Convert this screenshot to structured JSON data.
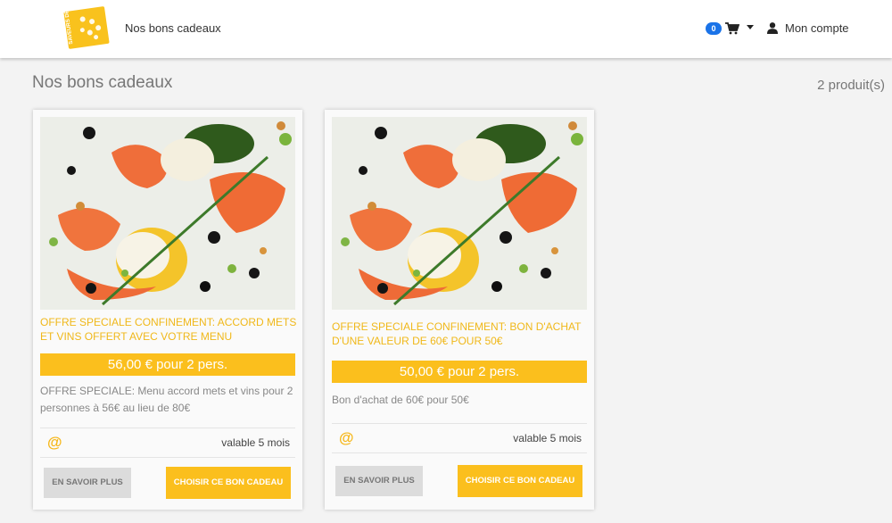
{
  "header": {
    "logo_text": "SAVEURS DES GRANDS CRUS",
    "nav_link": "Nos bons cadeaux",
    "cart_count": "0",
    "account_label": "Mon compte"
  },
  "page": {
    "title": "Nos bons cadeaux",
    "product_count": "2 produit(s)"
  },
  "products": [
    {
      "title": "OFFRE SPECIALE CONFINEMENT: ACCORD METS ET VINS OFFERT AVEC VOTRE MENU",
      "price": "56,00 € pour 2 pers.",
      "description": "OFFRE SPECIALE: Menu accord mets et vins pour 2 personnes à 56€ au lieu de 80€",
      "validity": "valable 5 mois",
      "more_label": "EN SAVOIR PLUS",
      "choose_label": "CHOISIR CE BON CADEAU"
    },
    {
      "title": "OFFRE SPECIALE CONFINEMENT: BON D'ACHAT D'UNE VALEUR DE 60€ POUR 50€",
      "price": "50,00 € pour 2 pers.",
      "description": "Bon d'achat de 60€ pour 50€",
      "validity": "valable 5 mois",
      "more_label": "EN SAVOIR PLUS",
      "choose_label": "CHOISIR CE BON CADEAU"
    }
  ],
  "colors": {
    "accent": "#fbbf1d",
    "title_text": "#f0b81a",
    "badge": "#1a73e8"
  },
  "icons": {
    "cart": "shopping-cart-icon",
    "user": "user-icon",
    "delivery": "at-sign-icon"
  }
}
